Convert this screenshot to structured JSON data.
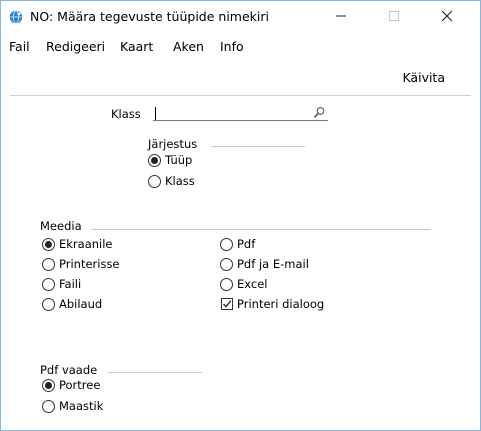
{
  "window": {
    "title": "NO: Määra tegevuste tüüpide nimekiri",
    "minimize_glyph": "—",
    "maximize_glyph": "☐",
    "close_glyph": "✕"
  },
  "menu": [
    "Fail",
    "Redigeeri",
    "Kaart",
    "Aken",
    "Info"
  ],
  "toolbar": {
    "run_label": "Käivita"
  },
  "form": {
    "class_label": "Klass",
    "class_value": "",
    "order_group": {
      "label": "Järjestus",
      "options": [
        {
          "label": "Tüüp",
          "selected": true
        },
        {
          "label": "Klass",
          "selected": false
        }
      ]
    },
    "media_group": {
      "label": "Meedia",
      "options_left": [
        {
          "label": "Ekraanile",
          "selected": true
        },
        {
          "label": "Printerisse",
          "selected": false
        },
        {
          "label": "Faili",
          "selected": false
        },
        {
          "label": "Abilaud",
          "selected": false
        }
      ],
      "options_right": [
        {
          "label": "Pdf",
          "selected": false
        },
        {
          "label": "Pdf ja E-mail",
          "selected": false
        },
        {
          "label": "Excel",
          "selected": false
        }
      ],
      "printer_dialog": {
        "label": "Printeri dialoog",
        "checked": true
      }
    },
    "pdf_group": {
      "label": "Pdf vaade",
      "options": [
        {
          "label": "Portree",
          "selected": true
        },
        {
          "label": "Maastik",
          "selected": false
        }
      ]
    }
  },
  "icons": {
    "app": "app-globe-icon",
    "lookup": "magnifier-icon"
  },
  "colors": {
    "window_border": "#8cb4d8",
    "app_icon": "#2f7fd0"
  }
}
